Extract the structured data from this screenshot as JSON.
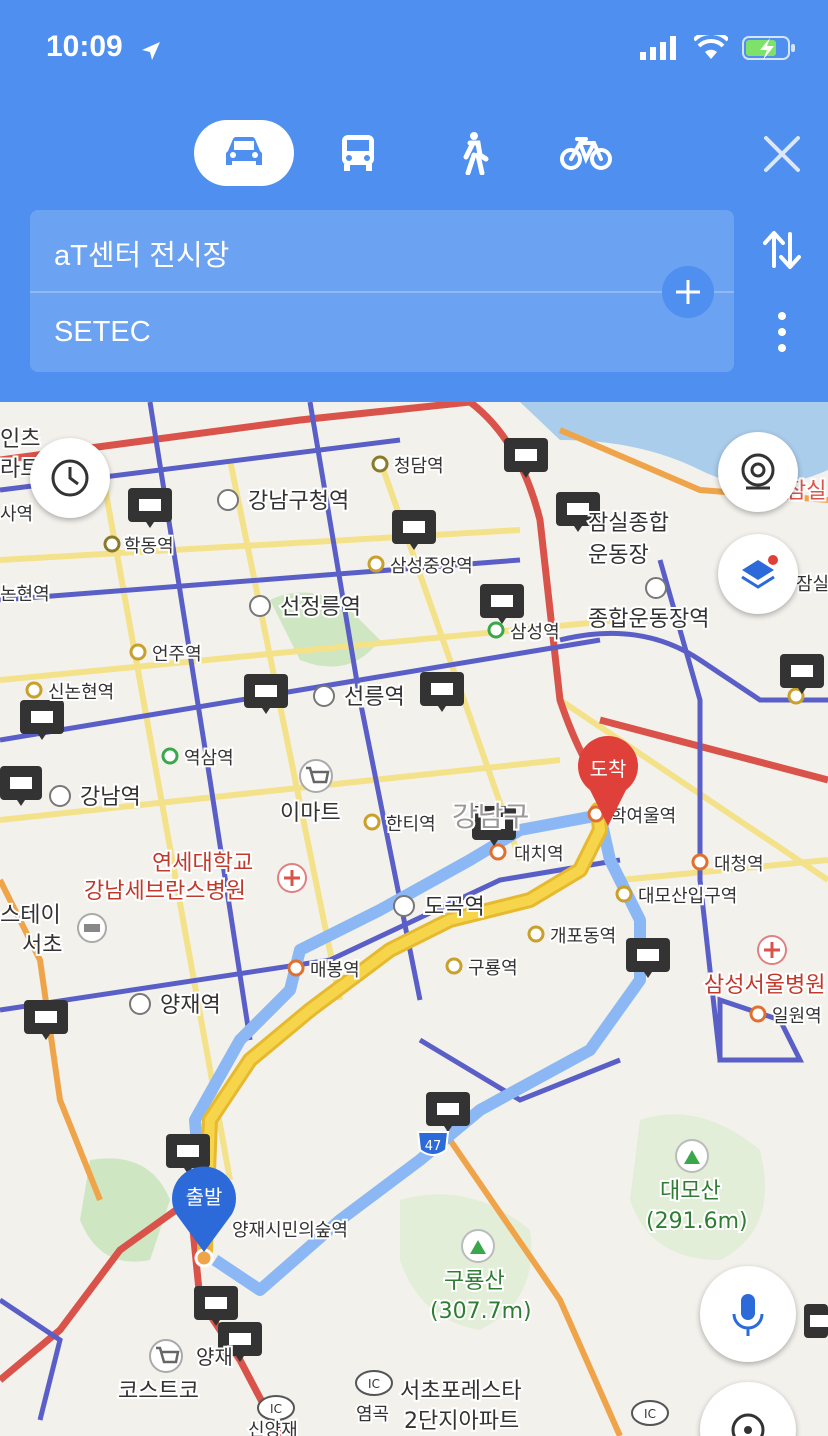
{
  "status": {
    "time": "10:09"
  },
  "route": {
    "origin": "aT센터 전시장",
    "destination": "SETEC"
  },
  "modes": [
    {
      "name": "drive",
      "active": true
    },
    {
      "name": "transit",
      "active": false
    },
    {
      "name": "walk",
      "active": false
    },
    {
      "name": "bike",
      "active": false
    }
  ],
  "markers": {
    "start": "출발",
    "end": "도착"
  },
  "road_shield": "47",
  "ic_badge": "IC",
  "labels": {
    "inchon": "인츠",
    "rae": "라트",
    "sayeok": "사역",
    "nonhyeon_w": "논현역",
    "chungdam": "청담역",
    "gangnamgu_office": "강남구청역",
    "hakdong": "학동역",
    "samsung_jungang": "삼성중앙역",
    "seonjeongneung": "선정릉역",
    "eonju": "언주역",
    "sinnonhyeon": "신논현역",
    "seolleung": "선릉역",
    "samseong": "삼성역",
    "sports_complex_1": "잠실종합",
    "sports_complex_2": "운동장",
    "sports_complex_station": "종합운동장역",
    "jamsil_r": "잠실",
    "jamsil_r2": "잠실",
    "yeoksam": "역삼역",
    "gangnam": "강남역",
    "emart": "이마트",
    "hanti": "한티역",
    "gangnamgu_area": "강남구",
    "daechi": "대치역",
    "hakyeoul": "학여울역",
    "daecheong": "대청역",
    "severance_1": "연세대학교",
    "severance_2": "강남세브란스병원",
    "daemosan_ipgu": "대모산입구역",
    "stay": "스테이",
    "seocho": "서초",
    "dogok": "도곡역",
    "gaepo": "개포동역",
    "maebong": "매봉역",
    "guryong": "구룡역",
    "samsung_hospital": "삼성서울병원",
    "irwon": "일원역",
    "yangjae": "양재역",
    "daemosan": "대모산",
    "daemosan_h": "(291.6m)",
    "guryongsan": "구룡산",
    "guryongsan_h": "(307.7m)",
    "yangjae_forest": "양재시민의숲역",
    "yangjae_s": "양재",
    "costco": "코스트코",
    "yeomgok": "염곡",
    "seocho_forest_1": "서초포레스타",
    "seocho_forest_2": "2단지아파트",
    "sinyang": "신양재"
  },
  "colors": {
    "header": "#4e8ff0",
    "route_primary": "#f2cc3f",
    "route_alt": "#8bb8f5",
    "start_marker": "#2b6ad8",
    "end_marker": "#e0403a",
    "subway_line": "#5a5fc8",
    "highway": "#d9534a"
  }
}
